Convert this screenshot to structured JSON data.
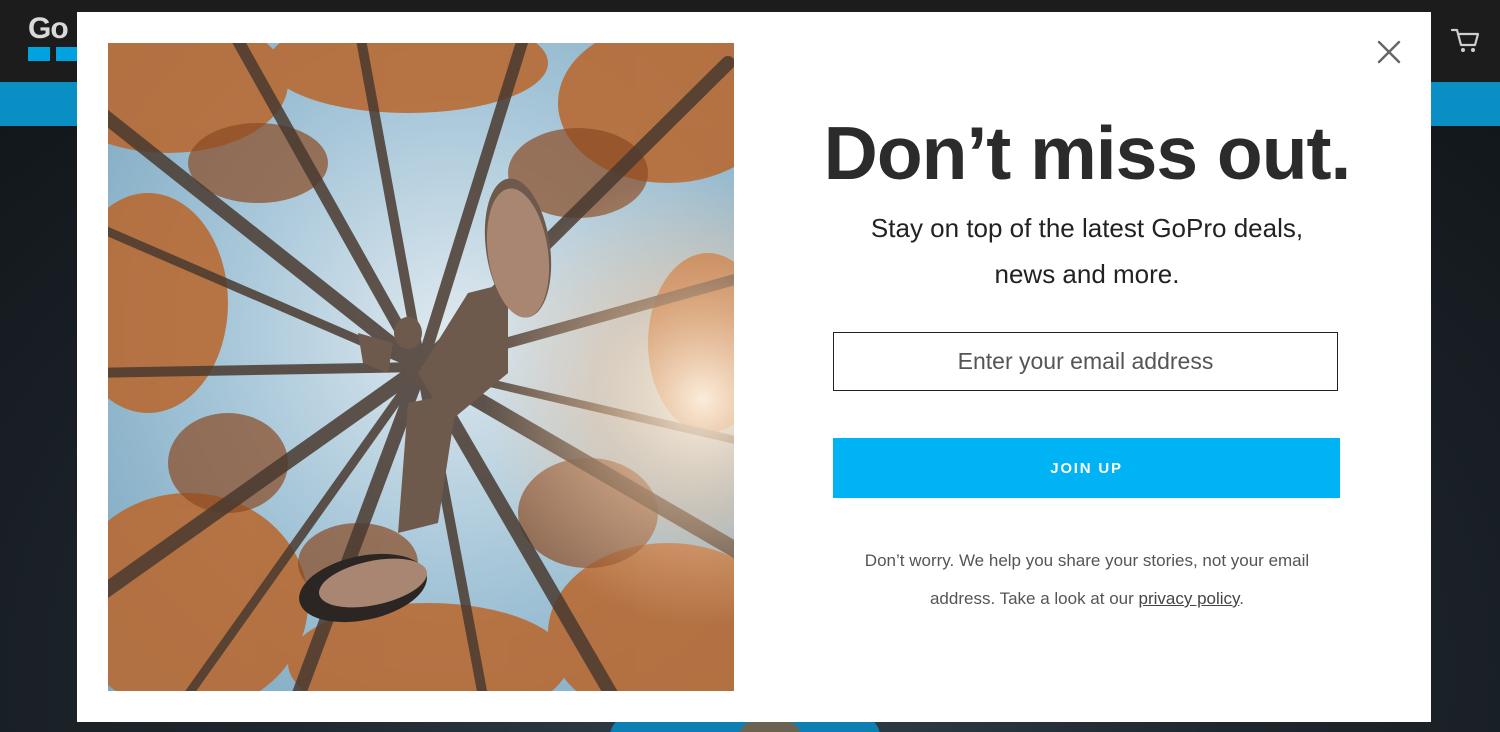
{
  "background": {
    "logo_text": "Go",
    "cart_icon": "shopping-cart-icon"
  },
  "modal": {
    "close_icon": "close-icon",
    "headline": "Don’t miss out.",
    "subhead_line1": "Stay on top of the latest GoPro deals,",
    "subhead_line2": "news and more.",
    "email_placeholder": "Enter your email address",
    "email_value": "",
    "join_button_label": "JOIN UP",
    "disclaimer_line1": "Don’t worry. We help you share your stories, not your email",
    "disclaimer_line2_prefix": "address. Take a look at our ",
    "privacy_link_label": "privacy policy",
    "disclaimer_line2_suffix": "."
  },
  "colors": {
    "accent": "#00b3f5",
    "brand_blue": "#00a3e0",
    "headline": "#2b2b2b"
  }
}
